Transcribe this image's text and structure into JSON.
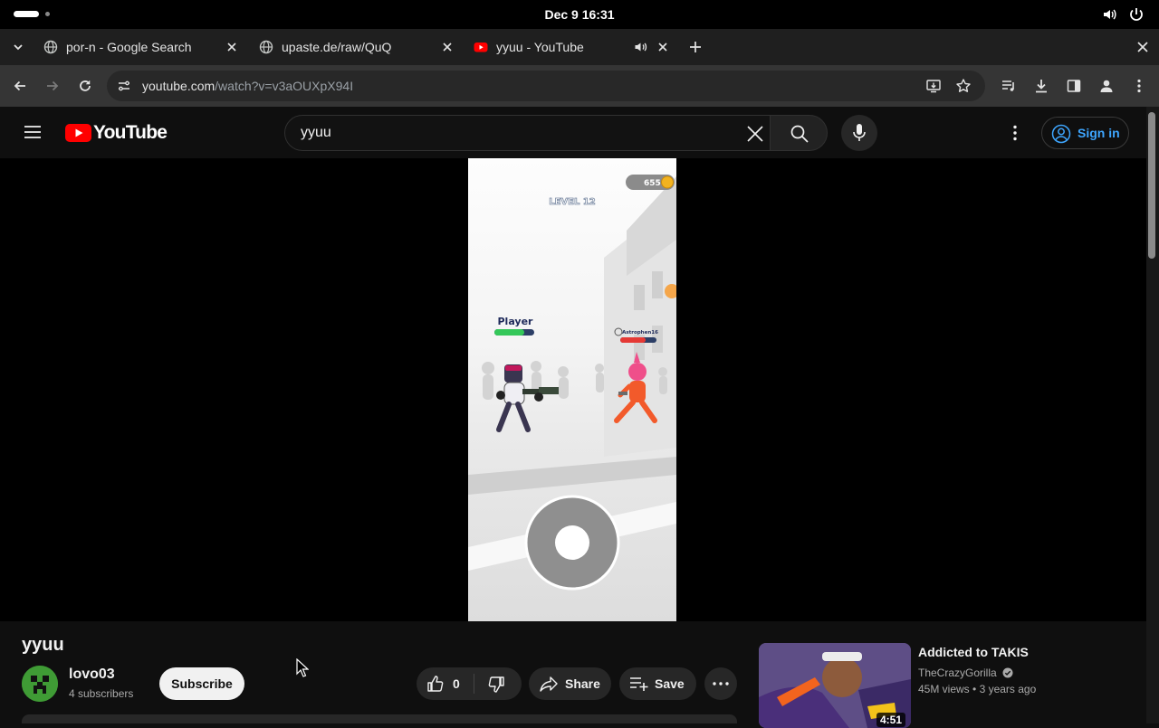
{
  "os": {
    "clock": "Dec 9  16:31"
  },
  "tabs": [
    {
      "title": "por-n - Google Search"
    },
    {
      "title": "upaste.de/raw/QuQ"
    },
    {
      "title": "yyuu - YouTube"
    }
  ],
  "omnibox": {
    "host": "youtube.com",
    "path": "/watch?v=v3aOUXpX94I"
  },
  "youtube": {
    "logo_text": "YouTube",
    "search_value": "yyuu",
    "signin_label": "Sign in"
  },
  "game": {
    "coins": "655",
    "level": "LEVEL 12",
    "player_label": "Player",
    "enemy_label": "Astrophen16",
    "player_health": 0.75,
    "enemy_health": 0.7
  },
  "video": {
    "title": "yyuu",
    "channel": "lovo03",
    "subscribers": "4 subscribers",
    "subscribe_label": "Subscribe",
    "likes": "0",
    "share_label": "Share",
    "save_label": "Save"
  },
  "recommended": [
    {
      "title": "Addicted to TAKIS",
      "channel": "TheCrazyGorilla",
      "views": "45M views",
      "age": "3 years ago",
      "duration": "4:51"
    }
  ],
  "colors": {
    "youtube_red": "#ff0000",
    "link_blue": "#3ea6ff",
    "player_green": "#34c759",
    "enemy_red": "#e53935"
  }
}
